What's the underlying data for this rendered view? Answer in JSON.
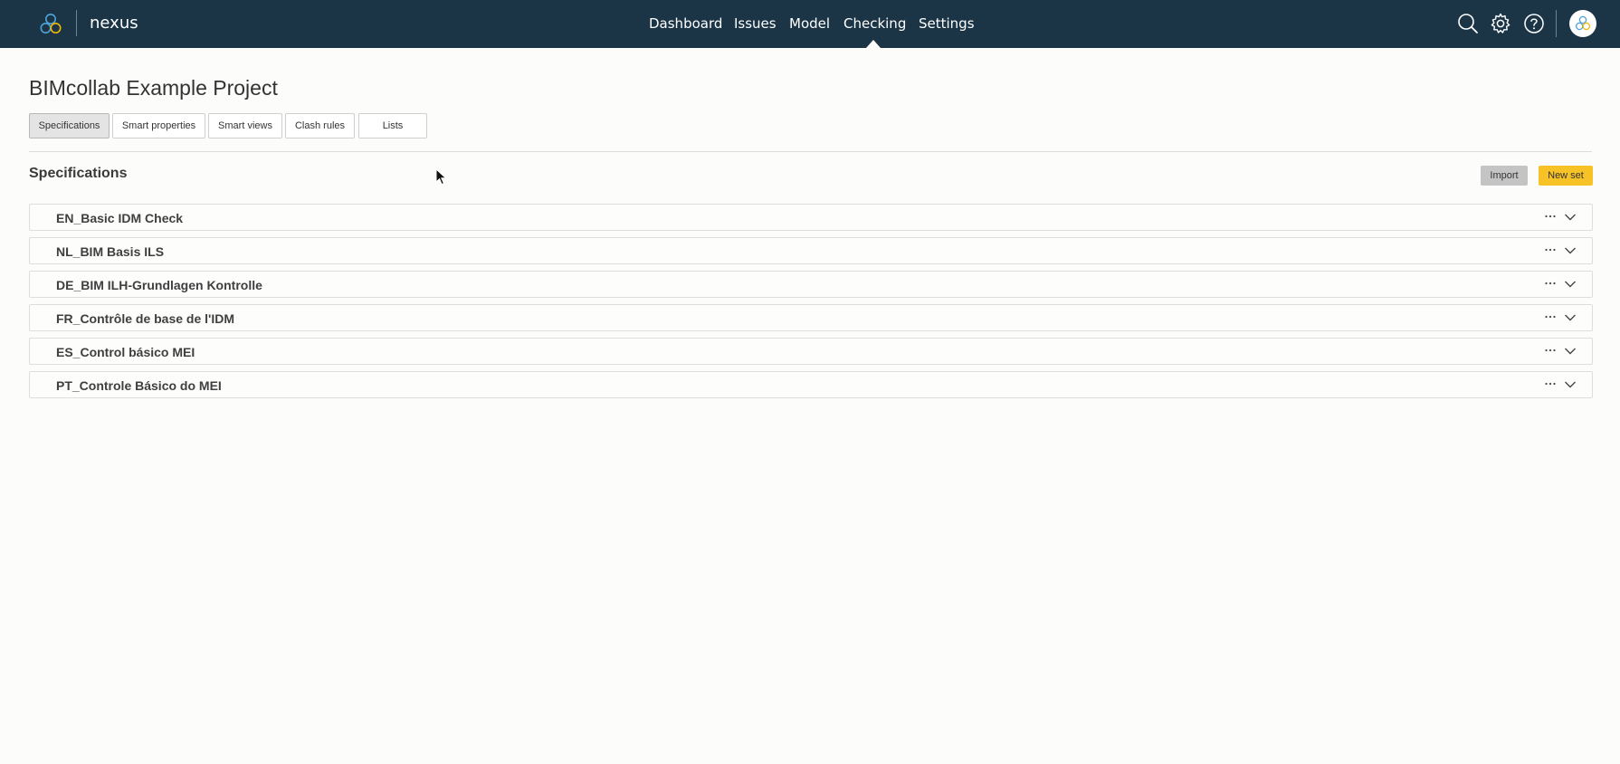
{
  "app": {
    "name": "nexus",
    "logo_icon": "nexus-logo-icon"
  },
  "nav": {
    "items": [
      {
        "label": "Dashboard"
      },
      {
        "label": "Issues"
      },
      {
        "label": "Model"
      },
      {
        "label": "Checking",
        "active": true
      },
      {
        "label": "Settings"
      }
    ]
  },
  "top_icons": [
    "search-icon",
    "gear-icon",
    "help-icon",
    "user-avatar"
  ],
  "page": {
    "title": "BIMcollab Example Project"
  },
  "tabs": [
    {
      "label": "Specifications",
      "active": true
    },
    {
      "label": "Smart properties"
    },
    {
      "label": "Smart views"
    },
    {
      "label": "Clash rules"
    },
    {
      "label": "Lists"
    }
  ],
  "section": {
    "title": "Specifications",
    "import_label": "Import",
    "new_set_label": "New set"
  },
  "specifications": [
    {
      "label": "EN_Basic IDM Check"
    },
    {
      "label": "NL_BIM Basis ILS"
    },
    {
      "label": "DE_BIM ILH-Grundlagen Kontrolle"
    },
    {
      "label": "FR_Contrôle de base de l'IDM"
    },
    {
      "label": "ES_Control básico MEI"
    },
    {
      "label": "PT_Controle Básico do MEI"
    }
  ],
  "colors": {
    "topbar": "#1b3547",
    "accent_button": "#f7c226",
    "secondary_button": "#c4c4c4",
    "background": "#fcfcfb"
  }
}
